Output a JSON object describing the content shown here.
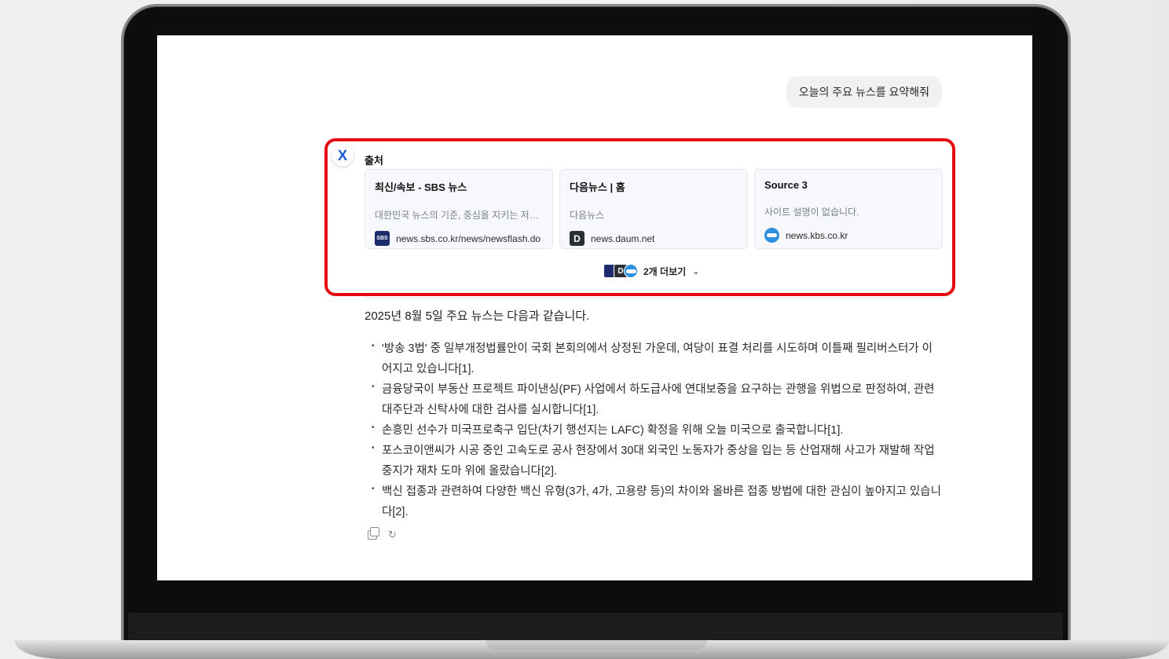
{
  "user_message": "오늘의 주요 뉴스를 요약해줘",
  "bot_avatar_icon": "x-logo-icon",
  "sources": {
    "title": "출처",
    "cards": [
      {
        "title": "최신/속보 - SBS 뉴스",
        "desc": "대한민국 뉴스의 기준, 중심을 지키는 저…",
        "domain": "news.sbs.co.kr/news/newsflash.do",
        "favicon": "SBS"
      },
      {
        "title": "다음뉴스 | 홈",
        "desc": "다음뉴스",
        "domain": "news.daum.net",
        "favicon": "D"
      },
      {
        "title": "Source 3",
        "desc": "사이트 설명이 없습니다.",
        "domain": "news.kbs.co.kr",
        "favicon": "kbs-icon"
      }
    ],
    "more_label": "2개 더보기",
    "highlight_color": "#e50914"
  },
  "answer": {
    "intro": "2025년 8월 5일 주요 뉴스는 다음과 같습니다.",
    "bullets": [
      "'방송 3법' 중 일부개정법률안이 국회 본회의에서 상정된 가운데, 여당이 표결 처리를 시도하며 이틀째 필리버스터가 이어지고 있습니다[1].",
      "금융당국이 부동산 프로젝트 파이낸싱(PF) 사업에서 하도급사에 연대보증을 요구하는 관행을 위법으로 판정하여, 관련 대주단과 신탁사에 대한 검사를 실시합니다[1].",
      "손흥민 선수가 미국프로축구 입단(차기 행선지는 LAFC) 확정을 위해 오늘 미국으로 출국합니다[1].",
      "포스코이앤씨가 시공 중인 고속도로 공사 현장에서 30대 외국인 노동자가 중상을 입는 등 산업재해 사고가 재발해 작업 중지가 재차 도마 위에 올랐습니다[2].",
      "백신 접종과 관련하여 다양한 백신 유형(3가, 4가, 고용량 등)의 차이와 올바른 접종 방법에 대한 관심이 높아지고 있습니다[2]."
    ]
  },
  "actions": {
    "copy_icon": "copy-icon",
    "retry_icon": "refresh-icon",
    "retry_glyph": "↻"
  }
}
